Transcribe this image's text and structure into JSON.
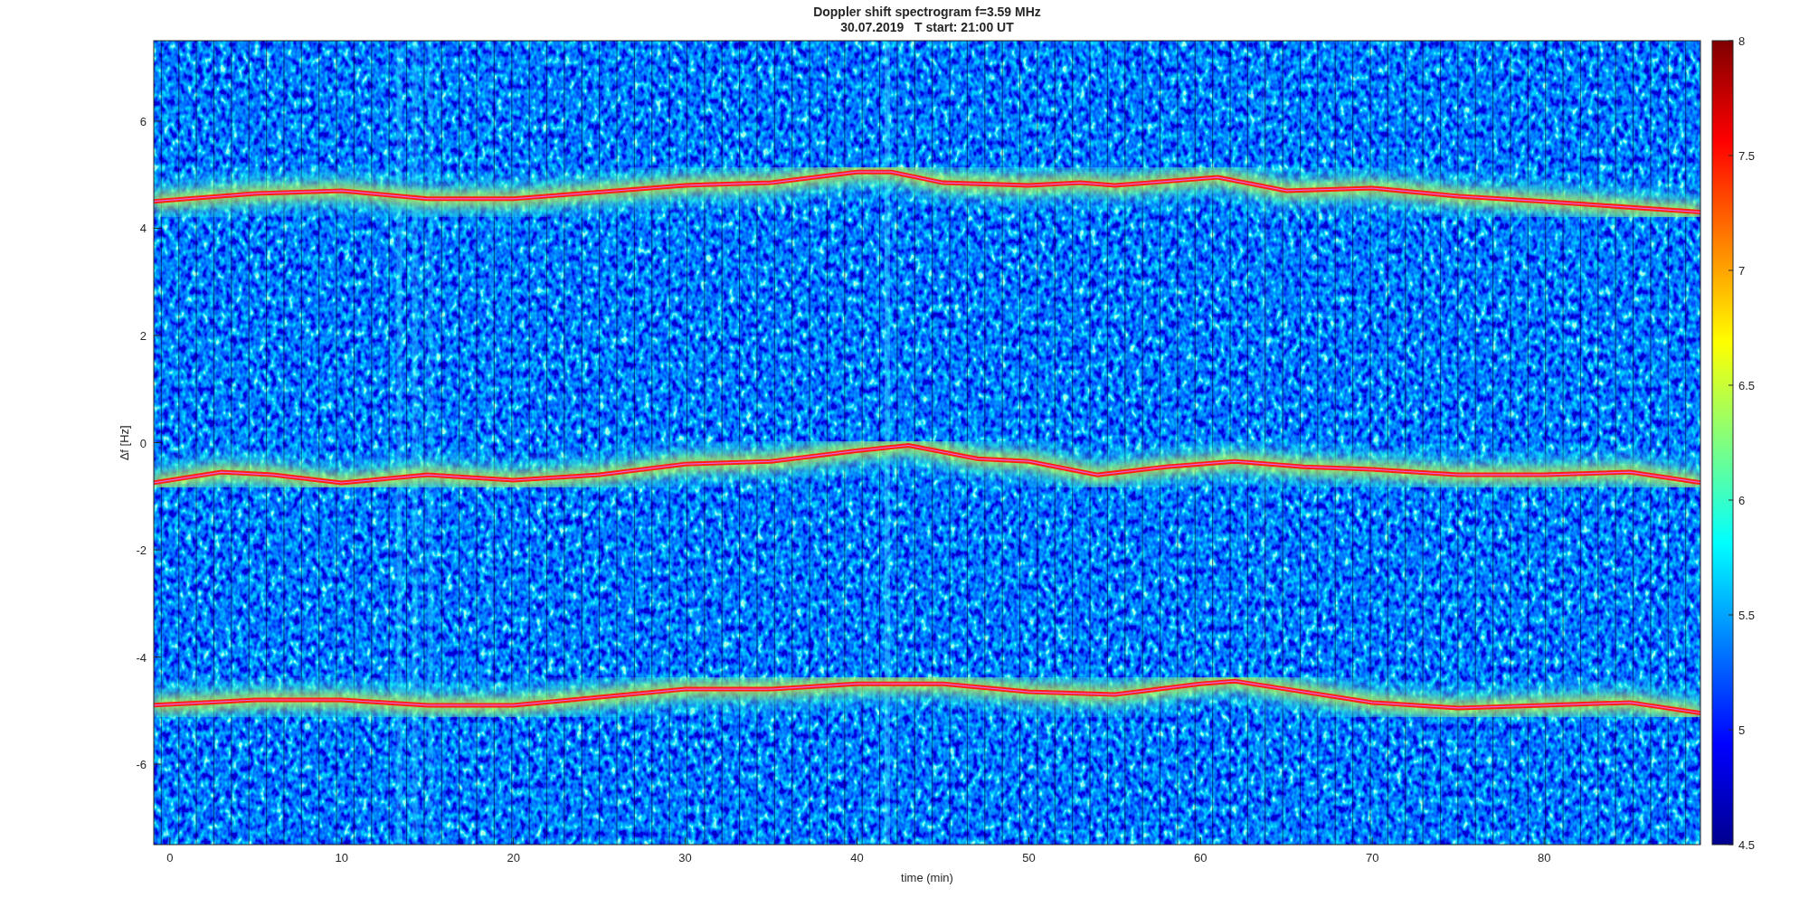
{
  "figure": {
    "title": "Doppler shift spectrogram f=3.59 MHz",
    "subtitle": "30.07.2019   T start: 21:00 UT"
  },
  "axes": {
    "xlabel": "time (min)",
    "ylabel": "∆f [Hz]",
    "xticks": [
      "0",
      "10",
      "20",
      "30",
      "40",
      "50",
      "60",
      "70",
      "80"
    ],
    "yticks": [
      "6",
      "4",
      "2",
      "0",
      "-2",
      "-4",
      "-6"
    ]
  },
  "colorbar": {
    "ticks": [
      "8",
      "7.5",
      "7",
      "6.5",
      "6",
      "5.5",
      "5",
      "4.5"
    ]
  }
}
